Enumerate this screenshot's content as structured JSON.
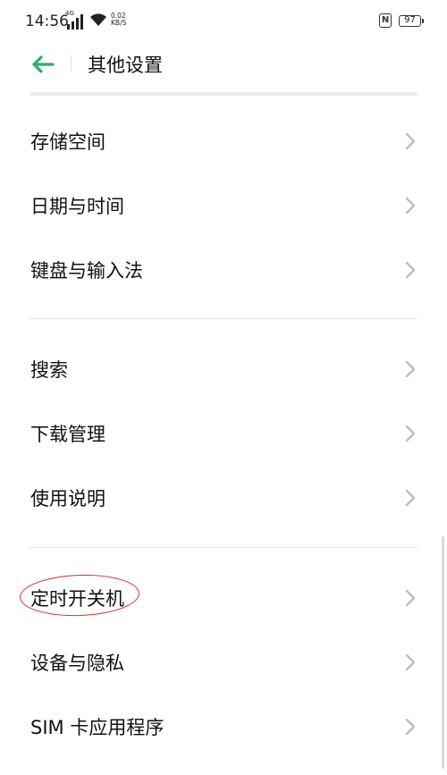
{
  "status_bar": {
    "time": "14:56",
    "network_tag": "4G",
    "net_speed_value": "0.02",
    "net_speed_unit": "KB/S",
    "nfc_label": "N",
    "battery": "97"
  },
  "header": {
    "title": "其他设置",
    "back_icon": "arrow-left-icon",
    "accent_color": "#27b36b"
  },
  "groups": [
    {
      "items": [
        {
          "label": "存储空间"
        },
        {
          "label": "日期与时间"
        },
        {
          "label": "键盘与输入法"
        }
      ]
    },
    {
      "items": [
        {
          "label": "搜索"
        },
        {
          "label": "下载管理"
        },
        {
          "label": "使用说明"
        }
      ]
    },
    {
      "items": [
        {
          "label": "定时开关机"
        },
        {
          "label": "设备与隐私"
        },
        {
          "label": "SIM 卡应用程序"
        }
      ]
    }
  ],
  "annotation": {
    "highlighted_item": "定时开关机",
    "color": "#d2322d"
  }
}
